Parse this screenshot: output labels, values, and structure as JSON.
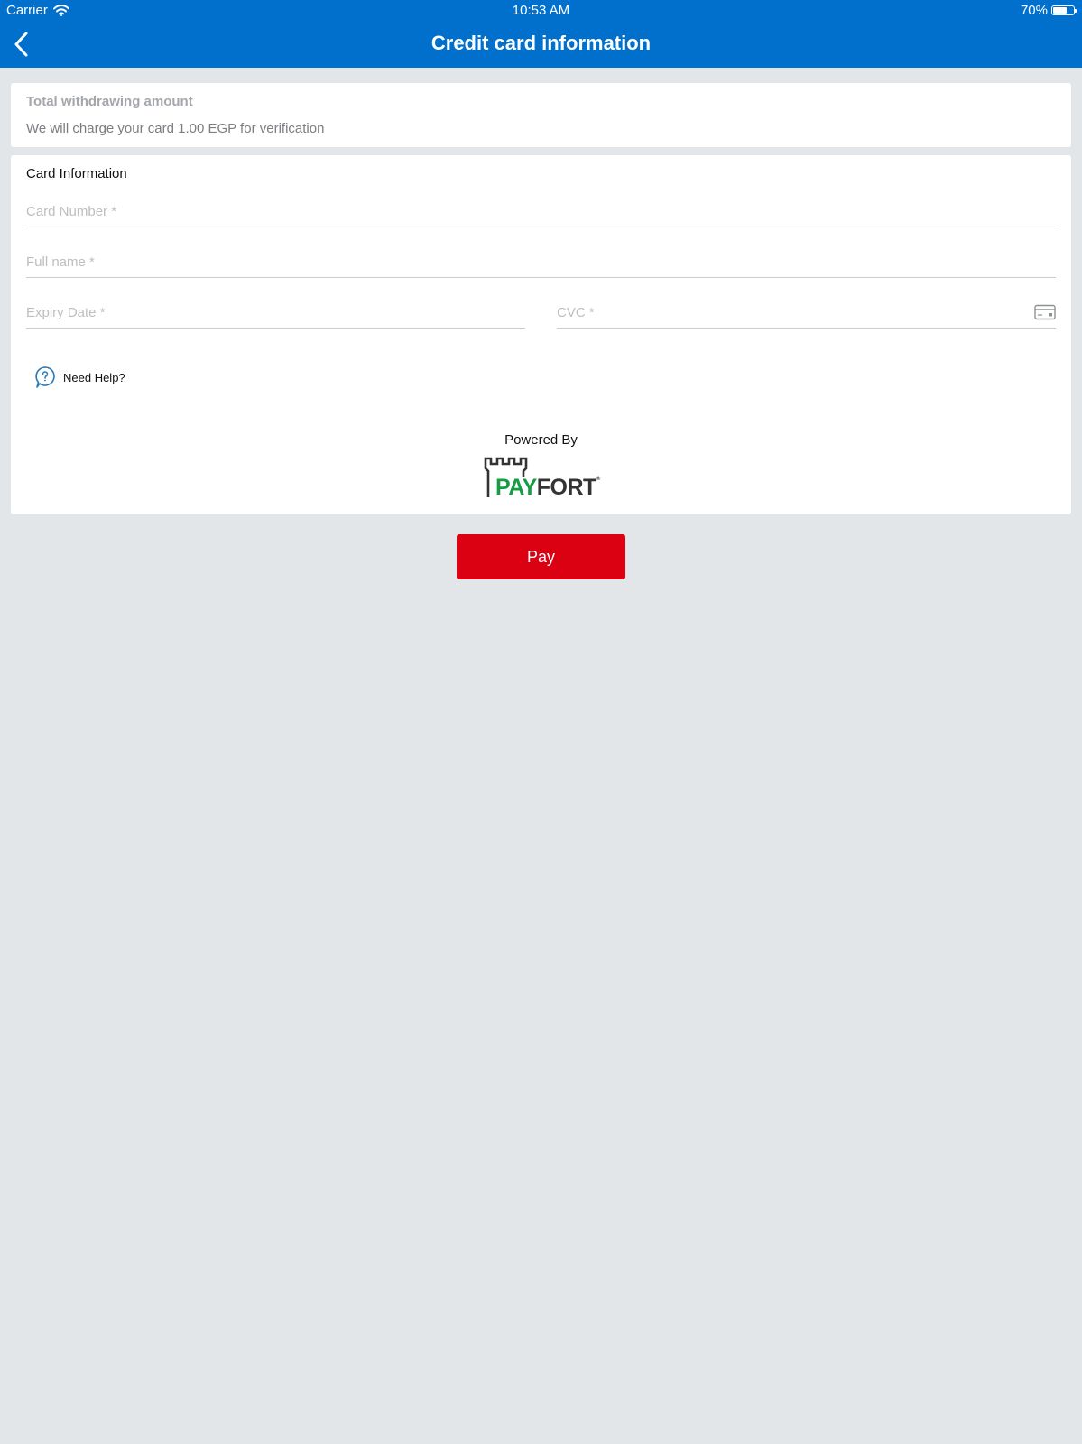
{
  "status_bar": {
    "carrier": "Carrier",
    "time": "10:53 AM",
    "battery_percent": "70%",
    "battery_level": 0.7
  },
  "nav": {
    "title": "Credit card information",
    "back_icon": "chevron-left-icon"
  },
  "amount_card": {
    "title": "Total withdrawing amount",
    "text": "We will charge your card 1.00 EGP for verification"
  },
  "card_info": {
    "title": "Card Information",
    "fields": {
      "card_number": {
        "placeholder": "Card Number *",
        "value": ""
      },
      "full_name": {
        "placeholder": "Full name *",
        "value": ""
      },
      "expiry": {
        "placeholder": "Expiry Date *",
        "value": ""
      },
      "cvc": {
        "placeholder": "CVC *",
        "value": ""
      }
    },
    "help_label": "Need Help?",
    "powered_by": "Powered By",
    "logo": {
      "pay": "PAY",
      "fort": "FORT",
      "mark": "®"
    }
  },
  "actions": {
    "pay_label": "Pay"
  },
  "colors": {
    "header": "#0070cc",
    "background": "#e2e6e9",
    "pay_button": "#dc0013",
    "logo_green": "#169c45",
    "logo_dark": "#333333"
  }
}
